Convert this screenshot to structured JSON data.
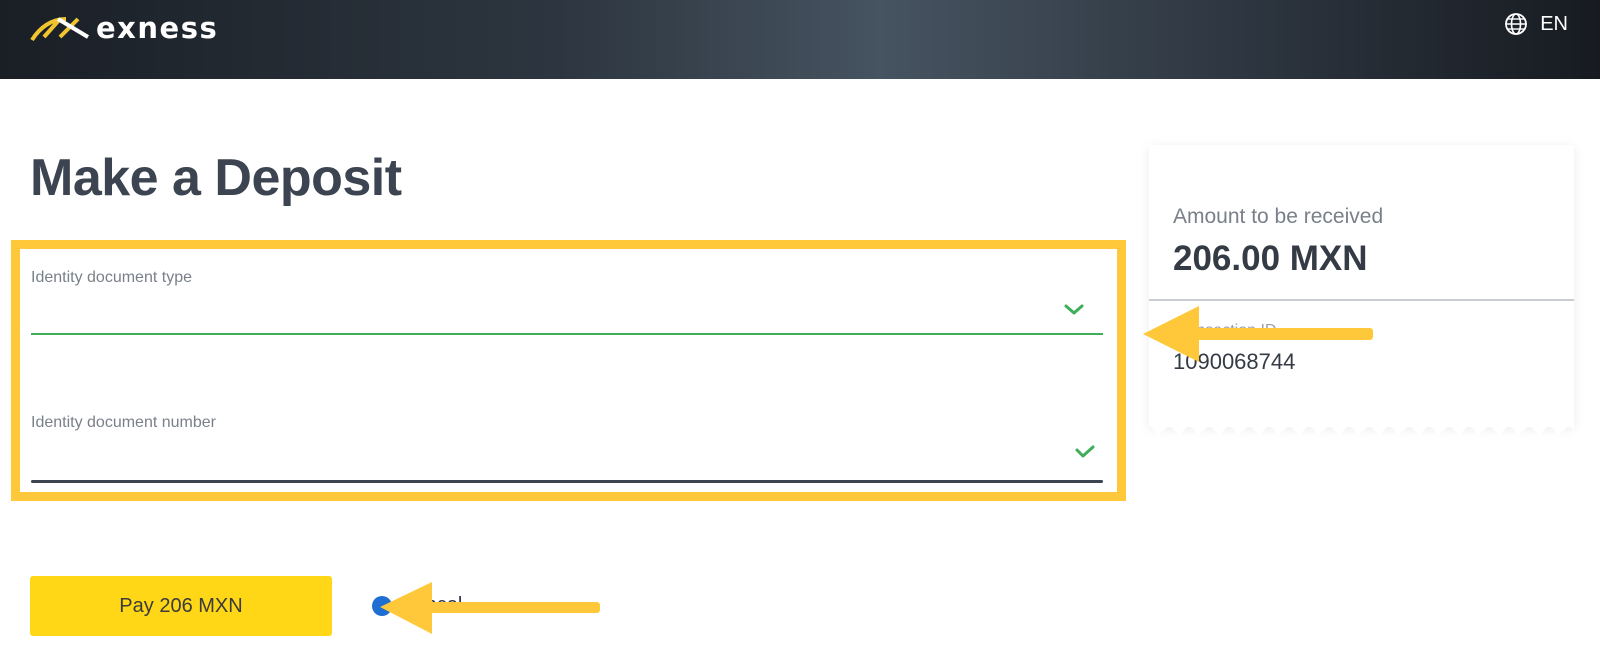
{
  "header": {
    "brand": "exness",
    "language": "EN",
    "logo_icon": "exness-logo-icon",
    "globe_icon": "globe-icon"
  },
  "page": {
    "title": "Make a Deposit"
  },
  "form": {
    "doc_type_label": "Identity document type",
    "doc_type_value": "",
    "doc_number_label": "Identity document number",
    "doc_number_value": ""
  },
  "summary": {
    "amount_label": "Amount to be received",
    "amount_value": "206.00 MXN",
    "tx_label": "Transaction ID",
    "tx_value": "1090068744"
  },
  "actions": {
    "pay_label": "Pay 206 MXN",
    "cancel_label": "Cancel"
  },
  "colors": {
    "accent_yellow": "#ffd717",
    "highlight": "#ffc83a",
    "valid_green": "#3fae5a",
    "title": "#3b4450"
  }
}
